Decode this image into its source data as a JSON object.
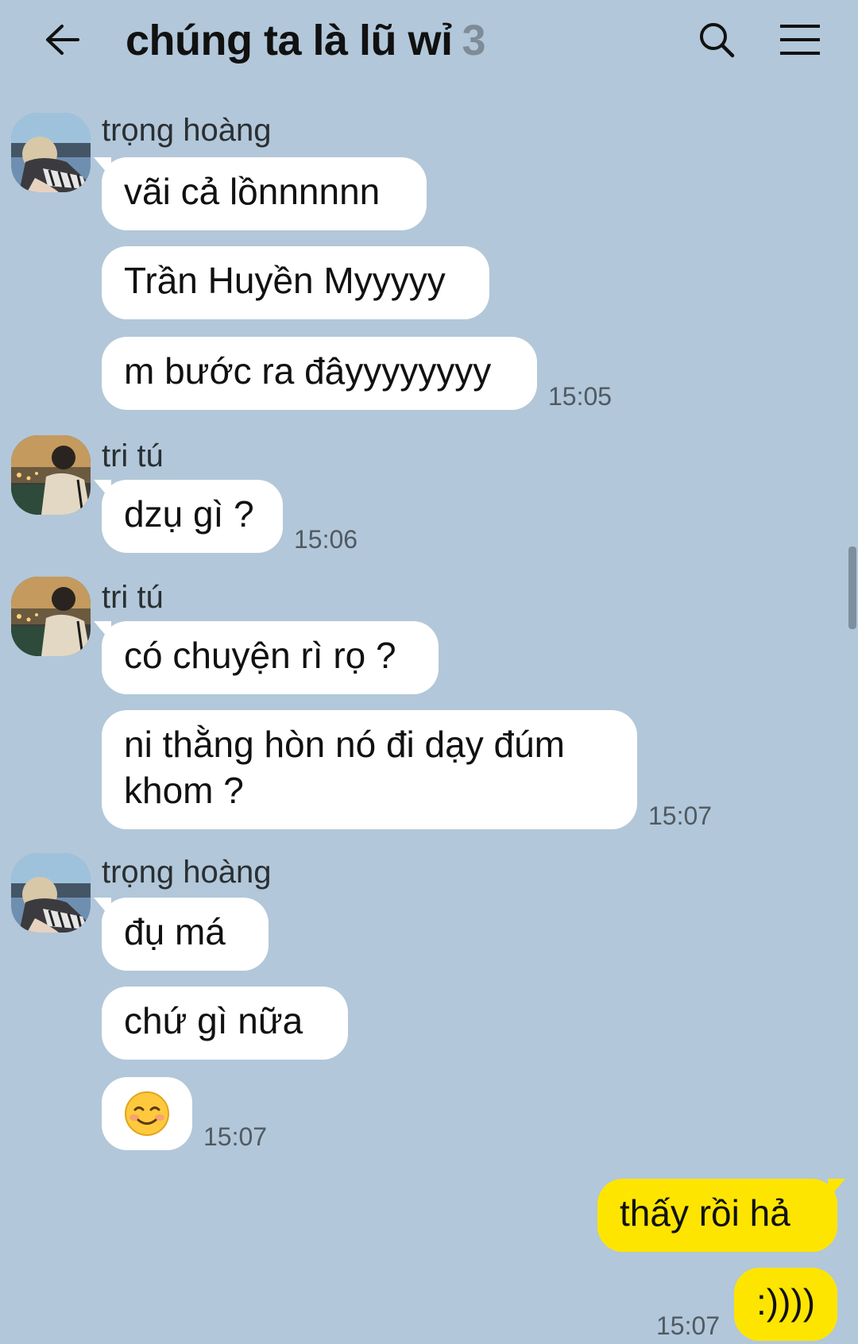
{
  "header": {
    "title": "chúng ta là lũ wỉ",
    "member_count": "3",
    "back_icon": "arrow-left-icon",
    "search_icon": "search-icon",
    "menu_icon": "hamburger-menu-icon"
  },
  "colors": {
    "background": "#b2c7d9",
    "bubble_other": "#ffffff",
    "bubble_mine": "#fee500",
    "count": "#7f8b96"
  },
  "messages": [
    {
      "sender": "trọng hoàng",
      "avatar": "avatar-trong-hoang",
      "lines": [
        "vãi cả lồnnnnnn",
        "Trần Huyền Myyyyy",
        "m bước ra đâyyyyyyyy"
      ],
      "time": "15:05"
    },
    {
      "sender": "tri tú",
      "avatar": "avatar-tri-tu",
      "lines": [
        "dzụ gì ?"
      ],
      "time": "15:06"
    },
    {
      "sender": "tri tú",
      "avatar": "avatar-tri-tu",
      "lines": [
        "có chuyện rì rọ ?",
        "ni thằng hòn nó đi dạy đúm\nkhom ?"
      ],
      "time": "15:07"
    },
    {
      "sender": "trọng hoàng",
      "avatar": "avatar-trong-hoang",
      "lines": [
        "đụ má",
        "chứ gì nữa",
        "smiling-face-emoji"
      ],
      "time": "15:07"
    },
    {
      "sender": "me",
      "lines": [
        "thấy rồi hả",
        ":))))"
      ],
      "time": "15:07"
    }
  ]
}
